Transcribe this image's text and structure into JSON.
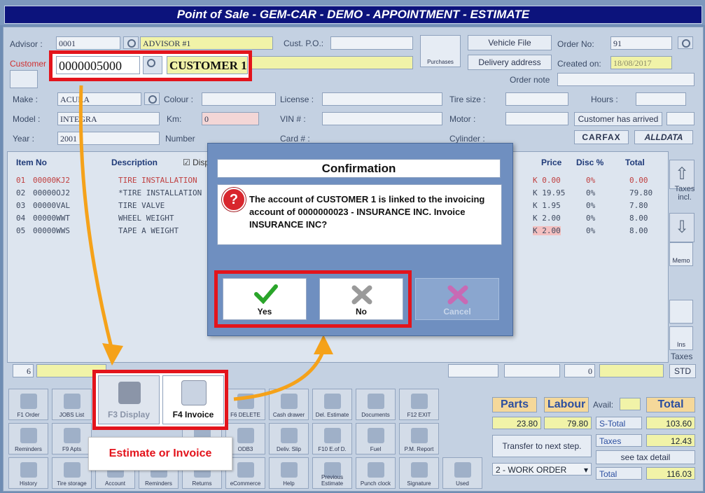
{
  "window": {
    "title": "Point of Sale - GEM-CAR - DEMO - APPOINTMENT - ESTIMATE"
  },
  "header": {
    "advisor_label": "Advisor :",
    "advisor_code": "0001",
    "advisor_name": "ADVISOR #1",
    "cust_po_label": "Cust. P.O.:",
    "customer_label": "Customer",
    "customer_code": "0000005000",
    "customer_name": "CUSTOMER 1",
    "purchases_label": "Purchases",
    "vehicle_file_label": "Vehicle File",
    "delivery_address_label": "Delivery address",
    "order_no_label": "Order No:",
    "order_no": "91",
    "created_on_label": "Created on:",
    "created_on": "18/08/2017",
    "order_note_label": "Order note"
  },
  "vehicle": {
    "make_label": "Make :",
    "make": "ACURA",
    "model_label": "Model :",
    "model": "INTEGRA",
    "year_label": "Year :",
    "year": "2001",
    "colour_label": "Colour :",
    "km_label": "Km:",
    "km": "0",
    "number_label": "Number",
    "license_label": "License :",
    "vin_label": "VIN # :",
    "card_label": "Card # :",
    "tire_size_label": "Tire size :",
    "motor_label": "Motor :",
    "cylinder_label": "Cylinder :",
    "hours_label": "Hours :",
    "customer_arrived_label": "Customer has arrived",
    "carfax_label": "CARFAX",
    "alldata_label": "ALLDATA"
  },
  "grid": {
    "headers": {
      "item_no": "Item No",
      "description": "Description",
      "disp": "Disp",
      "price": "Price",
      "disc": "Disc %",
      "total": "Total"
    },
    "rows": [
      {
        "n": "01",
        "item": "00000KJ2",
        "desc": "TIRE INSTALLATION",
        "price": "K 0.00",
        "disc": "0%",
        "total": "0.00",
        "red": true
      },
      {
        "n": "02",
        "item": "00000OJ2",
        "desc": "*TIRE INSTALLATION",
        "price": "K 19.95",
        "disc": "0%",
        "total": "79.80",
        "red": false
      },
      {
        "n": "03",
        "item": "00000VAL",
        "desc": "TIRE VALVE",
        "price": "K 1.95",
        "disc": "0%",
        "total": "7.80",
        "red": false
      },
      {
        "n": "04",
        "item": "00000WWT",
        "desc": "WHEEL WEIGHT",
        "price": "K 2.00",
        "disc": "0%",
        "total": "8.00",
        "red": false
      },
      {
        "n": "05",
        "item": "00000WWS",
        "desc": "TAPE A WEIGHT",
        "price": "K 2.00",
        "disc": "0%",
        "total": "8.00",
        "red": false
      }
    ],
    "count": "6",
    "zero": "0"
  },
  "right_panel": {
    "taxes_incl": "Taxes incl.",
    "memo": "Memo",
    "ins": "Ins",
    "taxes": "Taxes",
    "std": "STD"
  },
  "toolbar": {
    "row1": [
      "F1 Order",
      "JOBS List",
      "",
      "",
      "F5 ADD",
      "F6 DELETE",
      "Cash drawer",
      "Del. Estimate",
      "Documents",
      "F12 EXIT"
    ],
    "row2": [
      "Reminders",
      "F9 Apts",
      "",
      "",
      "Henson Tire",
      "ODB3",
      "Deliv. Slip",
      "F10 E.of D.",
      "Fuel",
      "P.M. Report"
    ],
    "row3": [
      "History",
      "Tire storage",
      "Account",
      "Reminders",
      "Returns",
      "eCommerce",
      "Help",
      "Previous Estimate",
      "Punch clock",
      "Signature",
      "Used"
    ],
    "f3_display": "F3 Display",
    "f4_invoice": "F4 Invoice"
  },
  "totals": {
    "parts_label": "Parts",
    "labour_label": "Labour",
    "avail_label": "Avail:",
    "total_label": "Total",
    "parts_value": "23.80",
    "labour_value": "79.80",
    "s_total_label": "S-Total",
    "s_total_value": "103.60",
    "taxes_label": "Taxes",
    "taxes_value": "12.43",
    "transfer_label": "Transfer to next step.",
    "see_tax_detail": "see tax detail",
    "work_order_option": "2 - WORK ORDER",
    "total_row_label": "Total",
    "total_value": "116.03"
  },
  "dialog": {
    "title": "Confirmation",
    "message": "The account of CUSTOMER 1 is linked to the invoicing account of 0000000023 - INSURANCE INC. Invoice INSURANCE INC?",
    "yes": "Yes",
    "no": "No",
    "cancel": "Cancel"
  },
  "annotation": {
    "callout": "Estimate or Invoice"
  },
  "colors": {
    "accent_red": "#e3141c",
    "arrow_orange": "#f5a21a",
    "title_bg": "#0c137c"
  }
}
